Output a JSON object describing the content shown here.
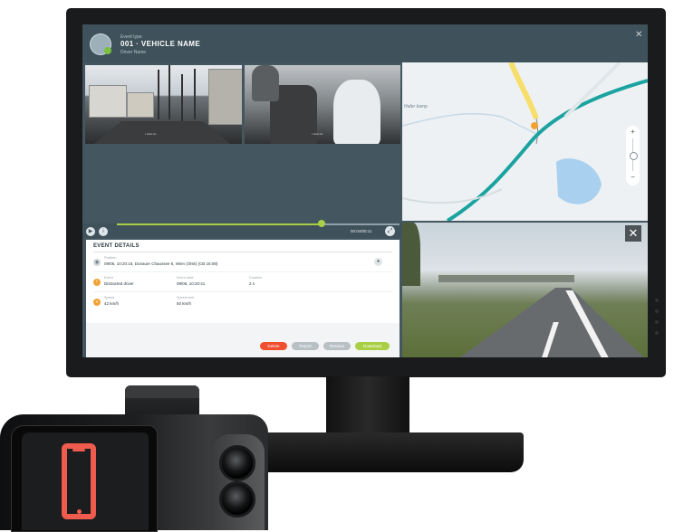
{
  "event": {
    "type_label": "Event type",
    "vehicle_name": "001 · VEHICLE NAME",
    "driver_name": "Driver Name"
  },
  "player": {
    "timecode": "00:04/00:11",
    "progress": 0.73
  },
  "details": {
    "title": "EVENT DETAILS",
    "position_label": "Position",
    "position_value": "09/06, 10:20:16, Donauer Chaussee 6, Wien (Olsk) (CB 18:08)",
    "event_label": "Event",
    "event_value": "Distracted driver",
    "event_start_label": "Event start",
    "event_start_value": "09/06, 10:20:41",
    "duration_label": "Duration",
    "duration_value": "2 s",
    "speed_label": "Speed",
    "speed_value": "42 km/h",
    "speed_limit_label": "Speed limit",
    "speed_limit_value": "50 km/h"
  },
  "actions": {
    "delete": "Delete",
    "report": "Report",
    "resolve": "Resolve",
    "download": "Download"
  },
  "colors": {
    "delete": "#f04e2f",
    "report": "#b8c0c4",
    "resolve": "#b8c0c4",
    "download": "#a9d044",
    "accent_green": "#a9d044",
    "warning_orange": "#f2a233",
    "phone_icon": "#ef5b4d"
  },
  "icons": {
    "close": "close-icon",
    "play": "play-icon",
    "info": "info-icon",
    "fullscreen": "fullscreen-icon",
    "pin": "location-pin-icon",
    "phone": "smartphone-icon"
  },
  "map": {
    "label": "Hafer kamp"
  }
}
